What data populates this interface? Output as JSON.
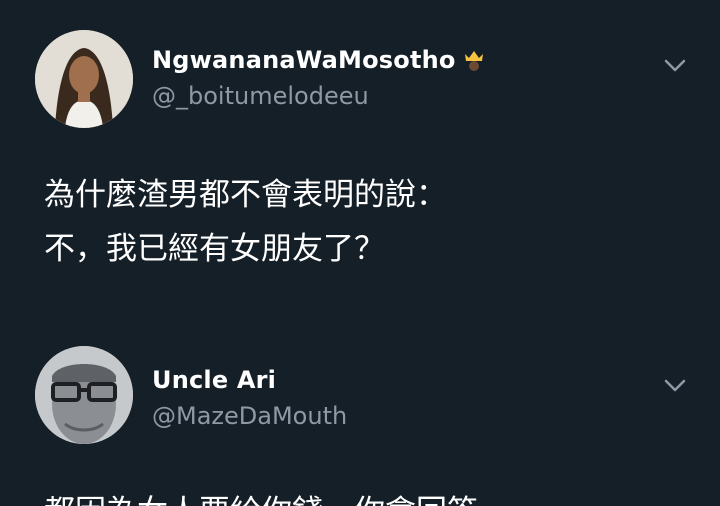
{
  "tweets": [
    {
      "display_name": "NgwananaWaMosotho",
      "handle": "@_boitumelodeeu",
      "name_badge_icon": "crown-icon",
      "text_lines": [
        "為什麼渣男都不會表明的說：",
        "不，我已經有女朋友了？"
      ]
    },
    {
      "display_name": "Uncle Ari",
      "handle": "@MazeDaMouth",
      "text_partial": "都因為女人要給你錢，你會回答"
    }
  ],
  "colors": {
    "background": "#151f28",
    "handle": "#8d99a5",
    "text": "#ffffff"
  }
}
